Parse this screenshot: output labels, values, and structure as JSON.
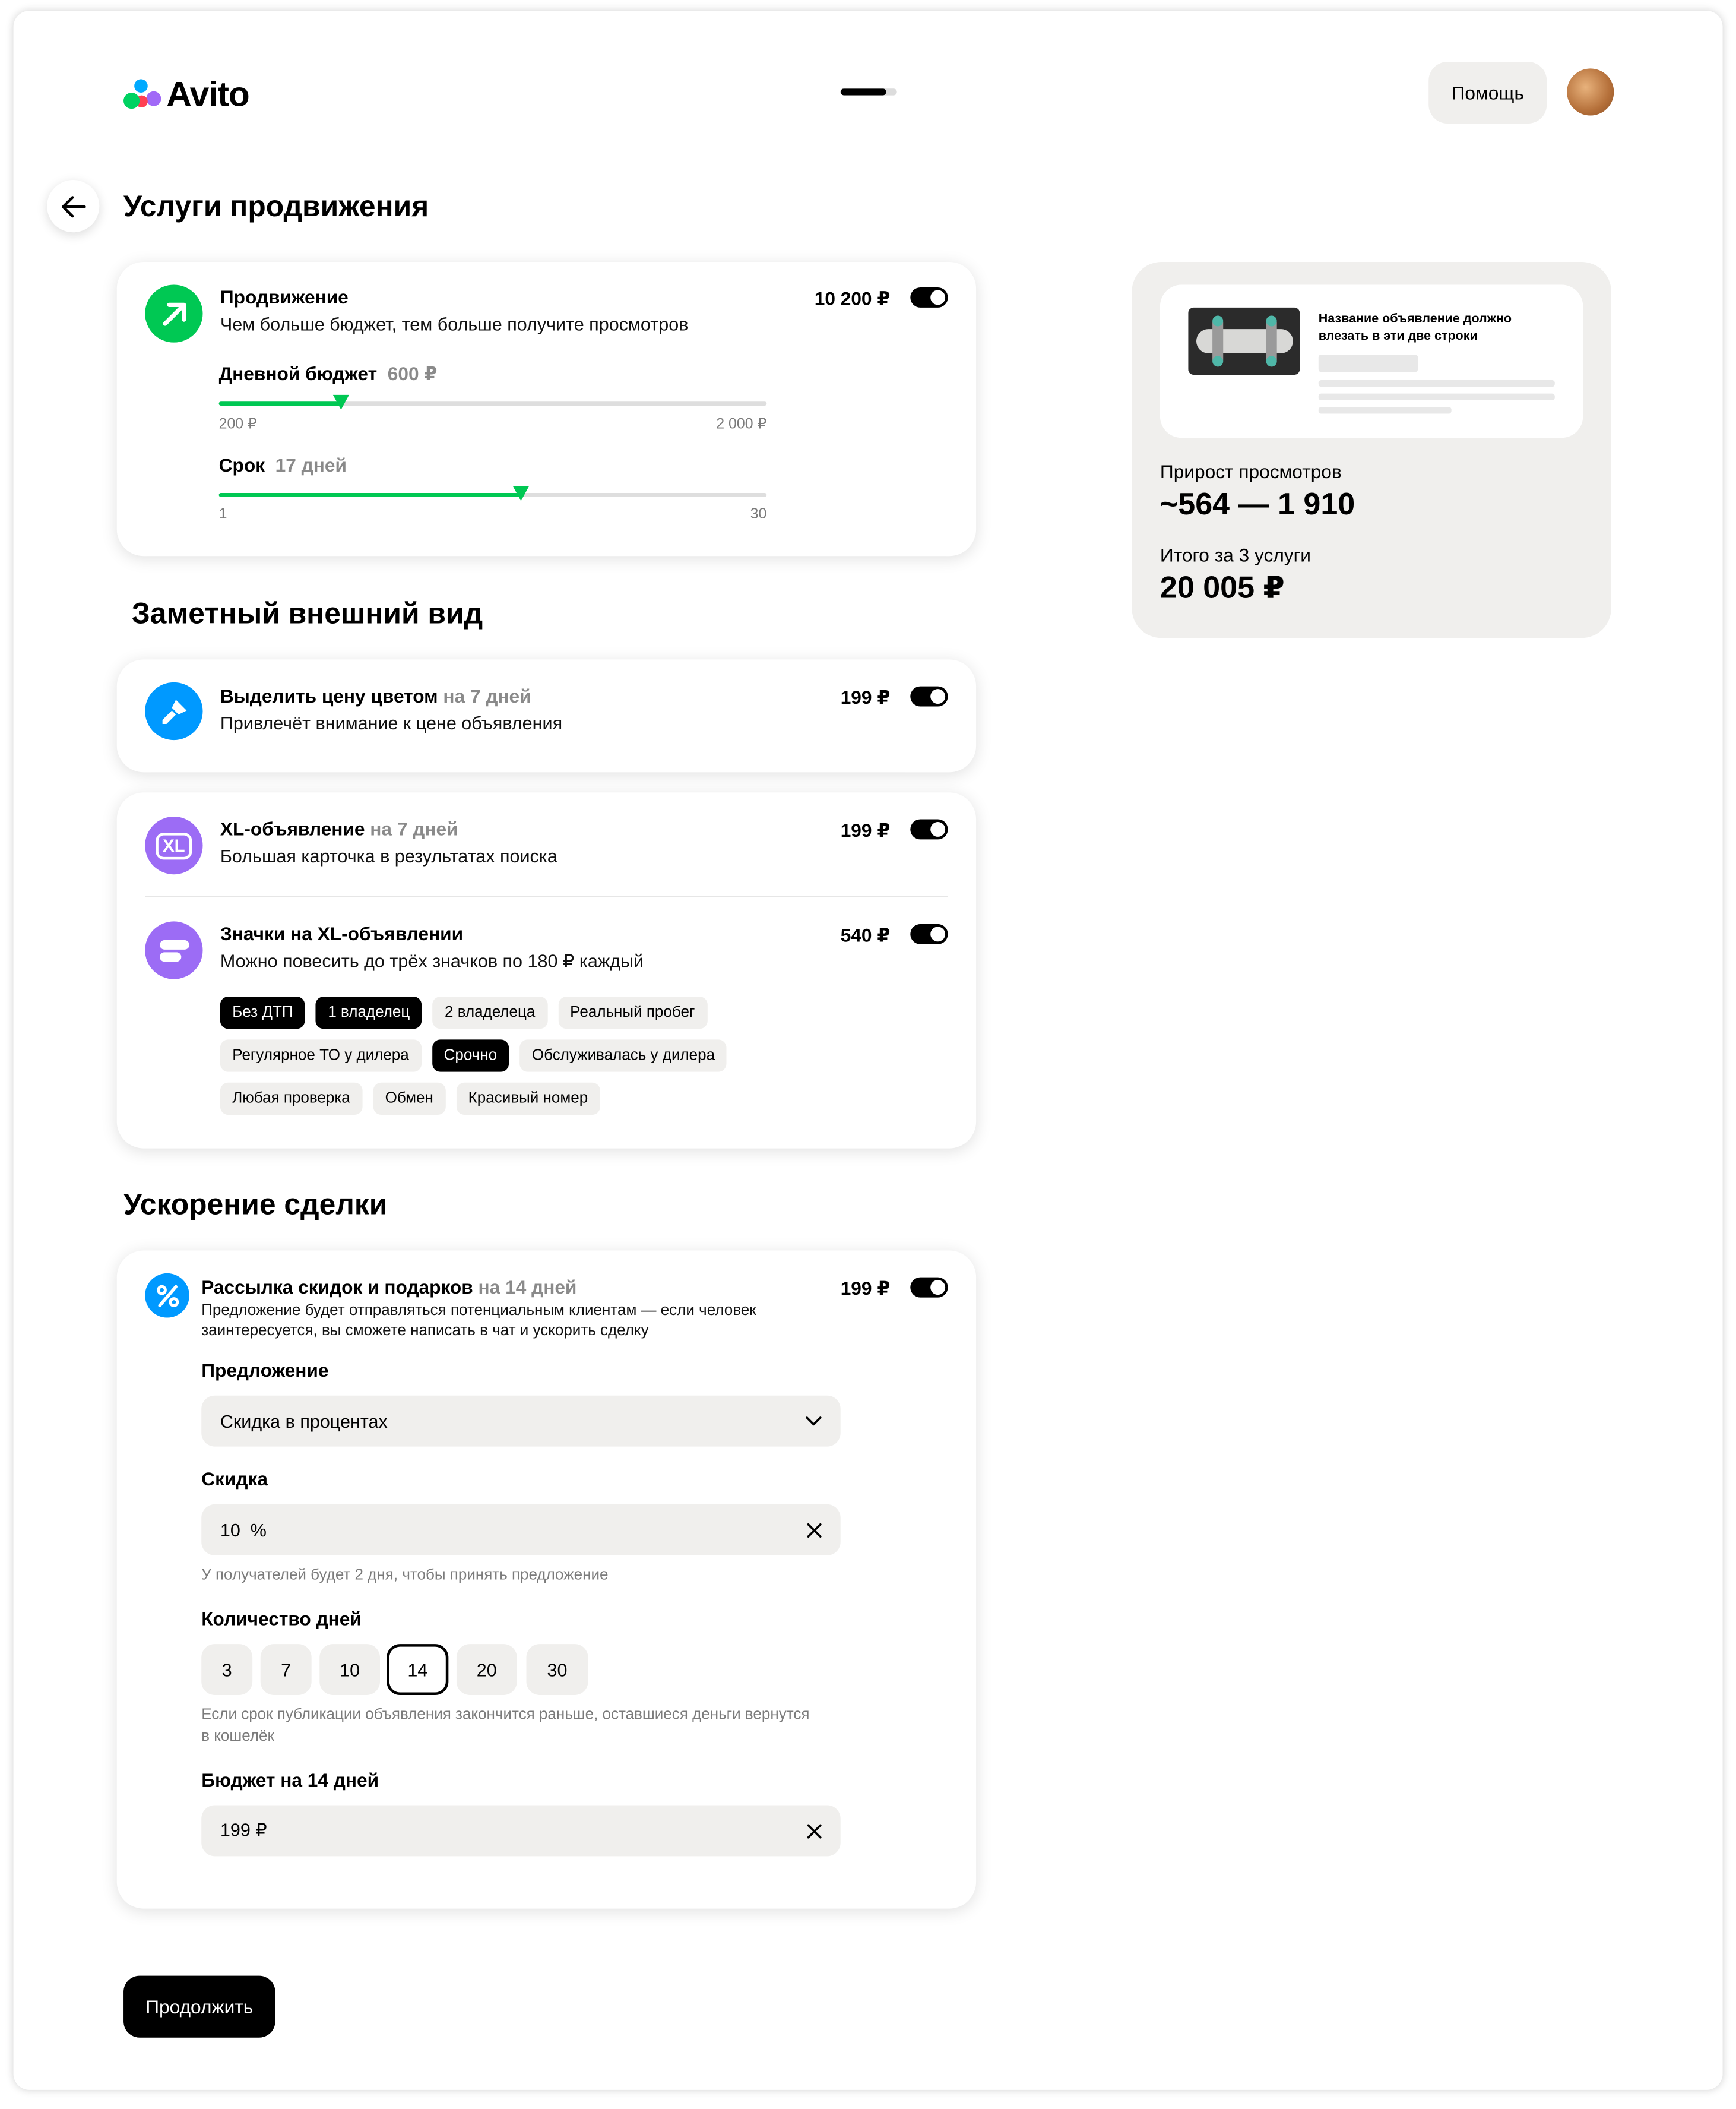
{
  "header": {
    "logo_text": "Avito",
    "logo_colors": [
      "#00aaff",
      "#a169f7",
      "#ff4053",
      "#00d261"
    ],
    "progress_fraction": 0.8,
    "help_label": "Помощь"
  },
  "page_title": "Услуги продвижения",
  "promotion": {
    "title": "Продвижение",
    "description": "Чем больше бюджет, тем больше получите просмотров",
    "price": "10 200 ₽",
    "enabled": true,
    "budget": {
      "label": "Дневной бюджет",
      "value_text": "600 ₽",
      "value": 600,
      "min": 200,
      "max": 2000,
      "min_label": "200 ₽",
      "max_label": "2 000 ₽"
    },
    "term": {
      "label": "Срок",
      "value_text": "17 дней",
      "value": 17,
      "min": 1,
      "max": 30,
      "min_label": "1",
      "max_label": "30"
    }
  },
  "appearance": {
    "heading": "Заметный внешний вид",
    "highlight": {
      "title": "Выделить цену цветом",
      "suffix": "на 7 дней",
      "description": "Привлечёт внимание к цене объявления",
      "price": "199 ₽",
      "enabled": true
    },
    "xl": {
      "icon_text": "XL",
      "title": "XL-объявление",
      "suffix": "на 7 дней",
      "description": "Большая карточка в результатах поиска",
      "price": "199 ₽",
      "enabled": true
    },
    "badges": {
      "title": "Значки на XL-объявлении",
      "description": "Можно повесить до трёх значков по 180 ₽ каждый",
      "price": "540 ₽",
      "enabled": true,
      "chips": [
        {
          "label": "Без ДТП",
          "selected": true
        },
        {
          "label": "1 владелец",
          "selected": true
        },
        {
          "label": "2 владелеца",
          "selected": false
        },
        {
          "label": "Реальный пробег",
          "selected": false
        },
        {
          "label": "Регулярное ТО у дилера",
          "selected": false
        },
        {
          "label": "Срочно",
          "selected": true
        },
        {
          "label": "Обслуживалась у дилера",
          "selected": false
        },
        {
          "label": "Любая проверка",
          "selected": false
        },
        {
          "label": "Обмен",
          "selected": false
        },
        {
          "label": "Красивый номер",
          "selected": false
        }
      ]
    }
  },
  "deal": {
    "heading": "Ускорение сделки",
    "mailing": {
      "title": "Рассылка скидок и подарков",
      "suffix": "на 14 дней",
      "description_line1": "Предложение будет отправляться потенциальным клиентам — если человек",
      "description_line2": "заинтересуется, вы сможете написать в чат и ускорить сделку",
      "price": "199 ₽",
      "enabled": true
    },
    "offer": {
      "label": "Предложение",
      "value": "Скидка в процентах"
    },
    "discount": {
      "label": "Скидка",
      "value": "10  %",
      "hint": "У получателей будет 2 дня, чтобы принять предложение"
    },
    "days": {
      "label": "Количество дней",
      "options": [
        "3",
        "7",
        "10",
        "14",
        "20",
        "30"
      ],
      "selected": "14",
      "hint_line1": "Если срок публикации объявления закончится раньше, оставшиеся деньги вернутся",
      "hint_line2": "в кошелёк"
    },
    "budget": {
      "label": "Бюджет на 14 дней",
      "value": "199 ₽"
    }
  },
  "continue_label": "Продолжить",
  "summary": {
    "preview_title": "Название объявление должно влезать в эти две строки",
    "views_label": "Прирост просмотров",
    "views_value": "~564 — 1 910",
    "total_label": "Итого за 3 услуги",
    "total_value": "20 005 ₽"
  },
  "colors": {
    "accent_green": "#00c853",
    "promo_icon": "#00c853",
    "highlight_icon": "#0099ff",
    "xl_icon": "#9c6cf5",
    "mailing_icon": "#0099ff",
    "surface_gray": "#f0efed"
  }
}
